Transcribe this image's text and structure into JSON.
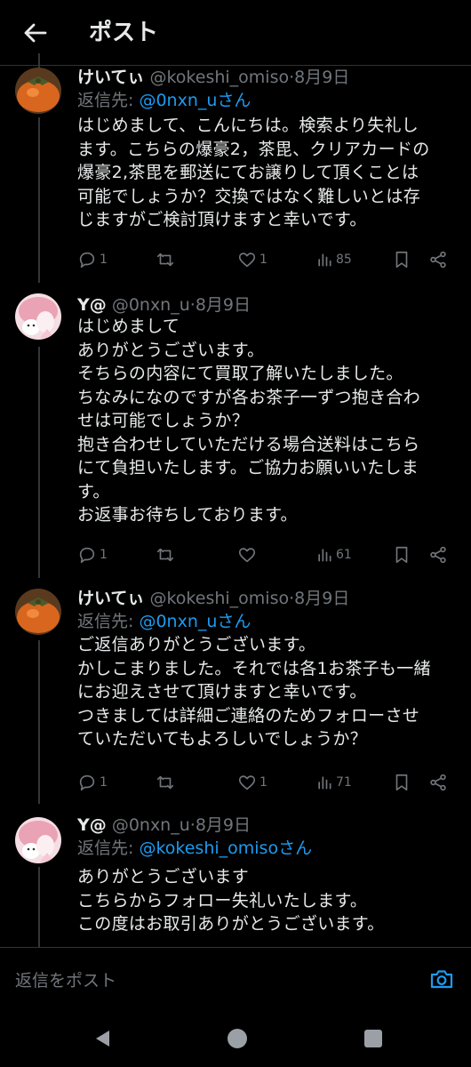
{
  "header": {
    "title": "ポスト"
  },
  "posts": [
    {
      "name": "けいてぃ",
      "handle": "@kokeshi_omiso",
      "dot": "·",
      "date": "8月9日",
      "reply_prefix": "返信先: ",
      "reply_to": "@0nxn_uさん",
      "text": "はじめまして、こんにちは。検索より失礼し\nます。こちらの爆豪2，茶毘、クリアカードの\n爆豪2,茶毘を郵送にてお譲りして頂くことは\n可能でしょうか？交換ではなく難しいとは存\nじますがご検討頂けますと幸いです。",
      "reply_count": "1",
      "repost_count": "",
      "like_count": "1",
      "view_count": "85"
    },
    {
      "name": "Y@",
      "handle": "@0nxn_u",
      "dot": "·",
      "date": "8月9日",
      "text": "はじめまして\nありがとうございます。\nそちらの内容にて買取了解いたしました。\nちなみになのですが各お茶子一ずつ抱き合わ\nせは可能でしょうか？\n抱き合わせしていただける場合送料はこちら\nにて負担いたします。ご協力お願いいたしま\nす。\nお返事お待ちしております。",
      "reply_count": "1",
      "repost_count": "",
      "like_count": "",
      "view_count": "61"
    },
    {
      "name": "けいてぃ",
      "handle": "@kokeshi_omiso",
      "dot": "·",
      "date": "8月9日",
      "reply_prefix": "返信先: ",
      "reply_to": "@0nxn_uさん",
      "text": "ご返信ありがとうございます。\nかしこまりました。それでは各1お茶子も一緒\nにお迎えさせて頂けますと幸いです。\nつきましては詳細ご連絡のためフォローさせ\nていただいてもよろしいでしょうか？",
      "reply_count": "1",
      "repost_count": "",
      "like_count": "1",
      "view_count": "71"
    },
    {
      "name": "Y@",
      "handle": "@0nxn_u",
      "dot": "·",
      "date": "8月9日",
      "reply_prefix": "返信先: ",
      "reply_to": "@kokeshi_omisoさん",
      "text": "ありがとうございます\nこちらからフォロー失礼いたします。\nこの度はお取引ありがとうございます。"
    }
  ],
  "composer": {
    "placeholder": "返信をポスト"
  },
  "icons": {
    "back": "arrow-left-icon",
    "reply": "reply-icon",
    "repost": "repost-icon",
    "like": "heart-icon",
    "views": "views-icon",
    "bookmark": "bookmark-icon",
    "share": "share-icon",
    "camera": "camera-icon",
    "nav_back": "nav-back-icon",
    "nav_home": "nav-home-icon",
    "nav_recents": "nav-recents-icon"
  },
  "colors": {
    "background": "#000000",
    "text": "#e7e9ea",
    "muted": "#71767b",
    "accent": "#1d9bf0",
    "divider": "#2f3336"
  }
}
